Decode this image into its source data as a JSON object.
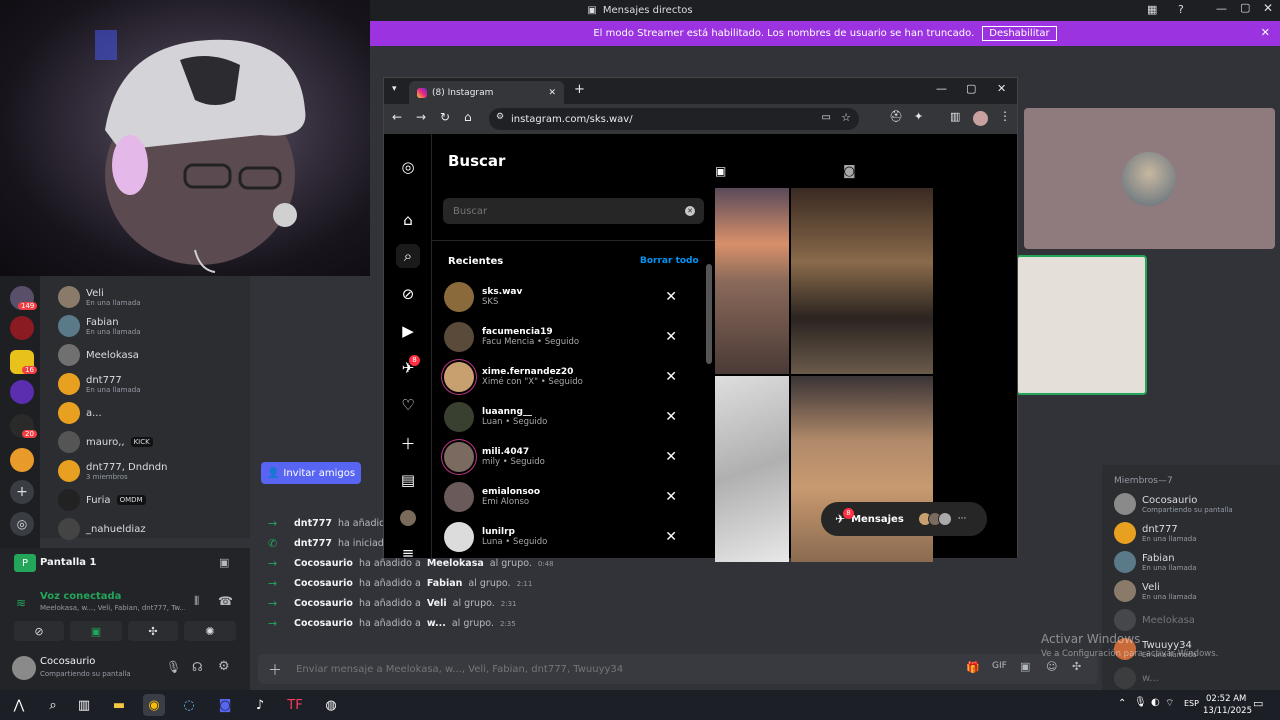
{
  "window": {
    "title": "Mensajes directos"
  },
  "banner": {
    "text": "El modo Streamer está habilitado. Los nombres de usuario se han truncado.",
    "button": "Deshabilitar"
  },
  "servers": {
    "badges": [
      "149",
      "16",
      "20"
    ]
  },
  "dm_list": [
    {
      "name": "Veli",
      "status": "En una llamada"
    },
    {
      "name": "Fabian",
      "status": "En una llamada"
    },
    {
      "name": "Meelokasa",
      "status": ""
    },
    {
      "name": "dnt777",
      "status": "En una llamada"
    },
    {
      "name": "a...",
      "status": ""
    },
    {
      "name": "mauro,,",
      "status": "",
      "tag": "KICK"
    },
    {
      "name": "dnt777, Dndndn",
      "status": "3 miembros"
    },
    {
      "name": "Furia",
      "status": "",
      "tag": "OMDM"
    },
    {
      "name": "_nahueldiaz",
      "status": ""
    }
  ],
  "screen_share": {
    "label": "Pantalla 1"
  },
  "voice": {
    "title": "Voz conectada",
    "members": "Meelokasa, w..., Veli, Fabian, dnt777, Tw..."
  },
  "user": {
    "name": "Cocosaurio",
    "status": "Compartiendo su pantalla"
  },
  "invite_button": "Invitar amigos",
  "chat": [
    {
      "actor": "dnt777",
      "text": "ha añadido",
      "target": "",
      "suffix": "",
      "time": ""
    },
    {
      "actor": "dnt777",
      "text": "ha iniciado",
      "target": "",
      "suffix": "",
      "time": ""
    },
    {
      "actor": "Cocosaurio",
      "text": "ha añadido a",
      "target": "Meelokasa",
      "suffix": "al grupo.",
      "time": "0:48"
    },
    {
      "actor": "Cocosaurio",
      "text": "ha añadido a",
      "target": "Fabian",
      "suffix": "al grupo.",
      "time": "2:11"
    },
    {
      "actor": "Cocosaurio",
      "text": "ha añadido a",
      "target": "Veli",
      "suffix": "al grupo.",
      "time": "2:31"
    },
    {
      "actor": "Cocosaurio",
      "text": "ha añadido a",
      "target": "w...",
      "suffix": "al grupo.",
      "time": "2:35"
    }
  ],
  "composer": {
    "placeholder": "Enviar mensaje a Meelokasa, w..., Veli, Fabian, dnt777, Twuuyy34"
  },
  "members": {
    "header": "Miembros—7",
    "list": [
      {
        "name": "Cocosaurio",
        "status": "Compartiendo su pantalla"
      },
      {
        "name": "dnt777",
        "status": "En una llamada"
      },
      {
        "name": "Fabian",
        "status": "En una llamada"
      },
      {
        "name": "Veli",
        "status": "En una llamada"
      },
      {
        "name": "Meelokasa",
        "status": ""
      },
      {
        "name": "Twuuyy34",
        "status": "En una llamada"
      },
      {
        "name": "w...",
        "status": ""
      }
    ]
  },
  "activate_windows": {
    "title": "Activar Windows",
    "subtitle": "Ve a Configuración para activar Windows."
  },
  "browser": {
    "tab_title": "(8) Instagram",
    "url": "instagram.com/sks.wav/",
    "nav_badge": "8",
    "search": {
      "title": "Buscar",
      "placeholder": "Buscar",
      "recent_label": "Recientes",
      "clear_all": "Borrar todo"
    },
    "recents": [
      {
        "user": "sks.wav",
        "desc": "SKS",
        "avatar_color": "#8a6a3a"
      },
      {
        "user": "facumencia19",
        "desc": "Facu Mencia • Seguido",
        "avatar_color": "#5a4a3a"
      },
      {
        "user": "xime.fernandez20",
        "desc": "Ximé con \"X\" • Seguido",
        "avatar_color": "#c8a070"
      },
      {
        "user": "luaanng__",
        "desc": "Luan • Seguido",
        "avatar_color": "#3a4030"
      },
      {
        "user": "mili.4047",
        "desc": "mily • Seguido",
        "avatar_color": "#7a6a60"
      },
      {
        "user": "emialonsoo",
        "desc": "Emi Alonso",
        "avatar_color": "#6a5a5a"
      },
      {
        "user": "lunilrp",
        "desc": "Luna • Seguido",
        "avatar_color": "#dcdcdc"
      }
    ],
    "messages": {
      "label": "Mensajes",
      "badge": "8"
    }
  },
  "taskbar": {
    "time": "02:52 AM",
    "date": "13/11/2025",
    "lang": "ESP"
  }
}
